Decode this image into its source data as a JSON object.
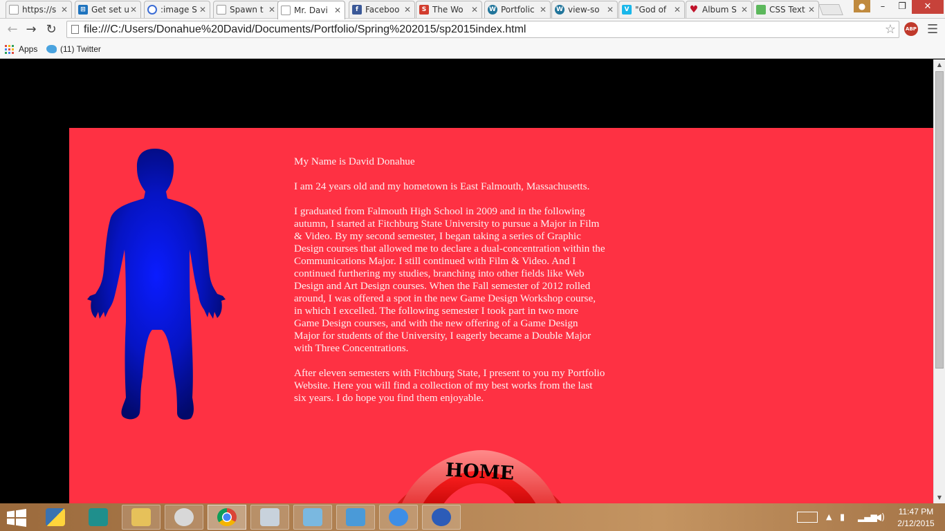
{
  "browser": {
    "tabs": [
      {
        "title": "https://s",
        "icon": "document-icon"
      },
      {
        "title": "Get set u",
        "icon": "windows-icon"
      },
      {
        "title": ":image S",
        "icon": "loading-icon"
      },
      {
        "title": "Spawn t",
        "icon": "document-icon"
      },
      {
        "title": "Mr. Davi",
        "icon": "document-icon",
        "active": true
      },
      {
        "title": "Faceboo",
        "icon": "facebook-icon"
      },
      {
        "title": "The Wo",
        "icon": "s-icon"
      },
      {
        "title": "Portfolic",
        "icon": "wordpress-icon"
      },
      {
        "title": "view-so",
        "icon": "wordpress-icon"
      },
      {
        "title": "\"God of",
        "icon": "vimeo-icon"
      },
      {
        "title": "Album S",
        "icon": "heart-icon"
      },
      {
        "title": "CSS Text",
        "icon": "css-icon"
      }
    ],
    "url": "file:///C:/Users/Donahue%20David/Documents/Portfolio/Spring%202015/sp2015index.html",
    "abp_label": "ABP",
    "bookmarks": {
      "apps": "Apps",
      "twitter": "(11) Twitter"
    }
  },
  "page": {
    "bio": [
      "My Name is David Donahue",
      "I am 24 years old and my hometown is East Falmouth, Massachusetts.",
      "I graduated from Falmouth High School in 2009 and in the following autumn, I started at Fitchburg State University to pursue a Major in Film & Video. By my second semester, I began taking a series of Graphic Design courses that allowed me to declare a dual-concentration within the Communications Major. I still continued with Film & Video. And I continued furthering my studies, branching into other fields like Web Design and Art Design courses. When the Fall semester of 2012 rolled around, I was offered a spot in the new Game Design Workshop course, in which I excelled. The following semester I took part in two more Game Design courses, and with the new offering of a Game Design Major for students of the University, I eagerly became a Double Major with Three Concentrations.",
      "After eleven semesters with Fitchburg State, I present to you my Portfolio Website. Here you will find a collection of my best works from the last six years. I do hope you find them enjoyable."
    ],
    "nav_home_label": "HOME",
    "colors": {
      "background": "#000000",
      "panel": "#fe3143",
      "text": "#fdeef0",
      "silhouette": "#0a1cff"
    }
  },
  "taskbar": {
    "apps": [
      "python-icon",
      "maya-icon",
      "file-explorer-icon",
      "snipping-tool-icon",
      "chrome-icon",
      "monitor-icon",
      "notepad-icon",
      "photo-viewer-icon",
      "itunes-icon",
      "media-player-icon"
    ],
    "time": "11:47 PM",
    "date": "2/12/2015"
  }
}
